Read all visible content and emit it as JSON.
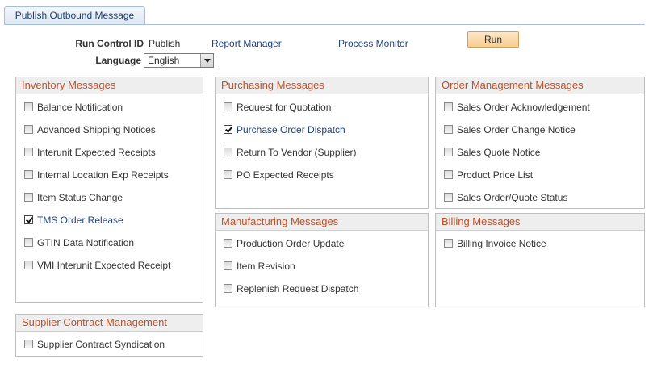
{
  "tab": {
    "label": "Publish Outbound Message"
  },
  "header": {
    "run_control_label": "Run Control ID",
    "run_control_value": "Publish",
    "report_manager": "Report Manager",
    "process_monitor": "Process Monitor",
    "run_label": "Run",
    "language_label": "Language",
    "language_value": "English"
  },
  "inventory": {
    "title": "Inventory Messages",
    "items": [
      {
        "label": "Balance Notification",
        "checked": false
      },
      {
        "label": "Advanced Shipping Notices",
        "checked": false
      },
      {
        "label": "Interunit Expected Receipts",
        "checked": false
      },
      {
        "label": "Internal Location Exp Receipts",
        "checked": false
      },
      {
        "label": "Item Status Change",
        "checked": false
      },
      {
        "label": "TMS Order Release",
        "checked": true
      },
      {
        "label": "GTIN Data Notification",
        "checked": false
      },
      {
        "label": "VMI Interunit Expected Receipt",
        "checked": false
      }
    ]
  },
  "purchasing": {
    "title": "Purchasing Messages",
    "items": [
      {
        "label": "Request for Quotation",
        "checked": false
      },
      {
        "label": "Purchase Order Dispatch",
        "checked": true
      },
      {
        "label": "Return To Vendor (Supplier)",
        "checked": false
      },
      {
        "label": "PO Expected Receipts",
        "checked": false
      }
    ]
  },
  "order_management": {
    "title": "Order Management Messages",
    "items": [
      {
        "label": "Sales Order Acknowledgement",
        "checked": false
      },
      {
        "label": "Sales Order Change Notice",
        "checked": false
      },
      {
        "label": "Sales Quote Notice",
        "checked": false
      },
      {
        "label": "Product Price List",
        "checked": false
      },
      {
        "label": "Sales Order/Quote Status",
        "checked": false
      }
    ]
  },
  "manufacturing": {
    "title": "Manufacturing Messages",
    "items": [
      {
        "label": "Production Order Update",
        "checked": false
      },
      {
        "label": "Item Revision",
        "checked": false
      },
      {
        "label": "Replenish Request Dispatch",
        "checked": false
      }
    ]
  },
  "billing": {
    "title": "Billing Messages",
    "items": [
      {
        "label": "Billing Invoice Notice",
        "checked": false
      }
    ]
  },
  "supplier_contract": {
    "title": "Supplier Contract Management",
    "items": [
      {
        "label": "Supplier Contract Syndication",
        "checked": false
      }
    ]
  }
}
